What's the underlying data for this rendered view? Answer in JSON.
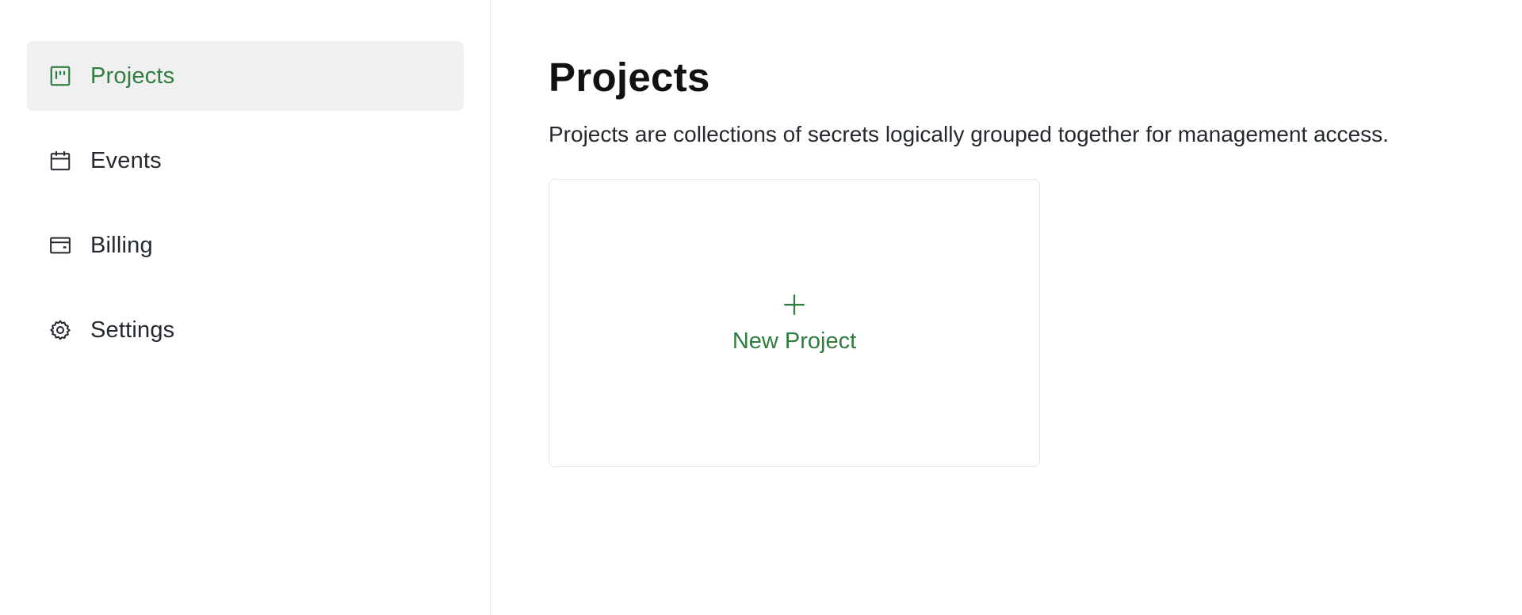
{
  "colors": {
    "accent": "#2f7d3f",
    "active_bg": "#f0f0f0",
    "text": "#24292f",
    "border": "#e6e6e6"
  },
  "sidebar": {
    "items": [
      {
        "label": "Projects",
        "icon": "projects-board-icon",
        "active": true
      },
      {
        "label": "Events",
        "icon": "calendar-icon",
        "active": false
      },
      {
        "label": "Billing",
        "icon": "wallet-icon",
        "active": false
      },
      {
        "label": "Settings",
        "icon": "gear-icon",
        "active": false
      }
    ]
  },
  "main": {
    "title": "Projects",
    "description": "Projects are collections of secrets logically grouped together for management access.",
    "new_card": {
      "icon": "plus-icon",
      "label": "New Project"
    }
  }
}
